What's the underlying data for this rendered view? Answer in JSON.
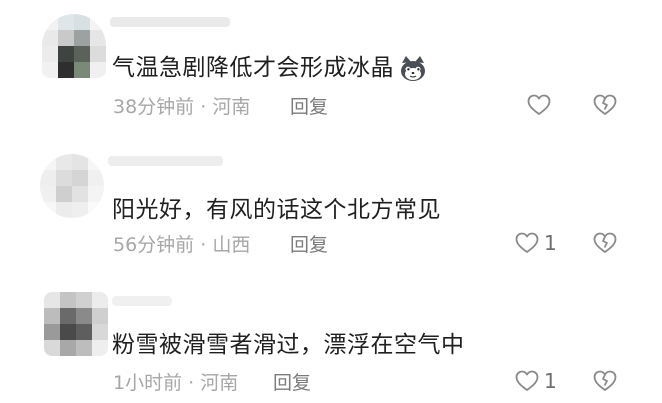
{
  "icons": {
    "like": "heart-outline-icon",
    "dislike": "broken-heart-outline-icon",
    "emoji": "cat-face-emoji"
  },
  "colors": {
    "text": "#1f1f1f",
    "meta": "#a7a7a7",
    "reply": "#7b7b7b",
    "icon": "#8a8a8a"
  },
  "comments": [
    {
      "text": "气温急剧降低才会形成冰晶",
      "has_emoji": true,
      "time": "38分钟前",
      "separator": "·",
      "location": "河南",
      "reply_label": "回复",
      "like_count": ""
    },
    {
      "text": "阳光好，有风的话这个北方常见",
      "has_emoji": false,
      "time": "56分钟前",
      "separator": "·",
      "location": "山西",
      "reply_label": "回复",
      "like_count": "1"
    },
    {
      "text": "粉雪被滑雪者滑过，漂浮在空气中",
      "has_emoji": false,
      "time": "1小时前",
      "separator": "·",
      "location": "河南",
      "reply_label": "回复",
      "like_count": "1"
    }
  ]
}
